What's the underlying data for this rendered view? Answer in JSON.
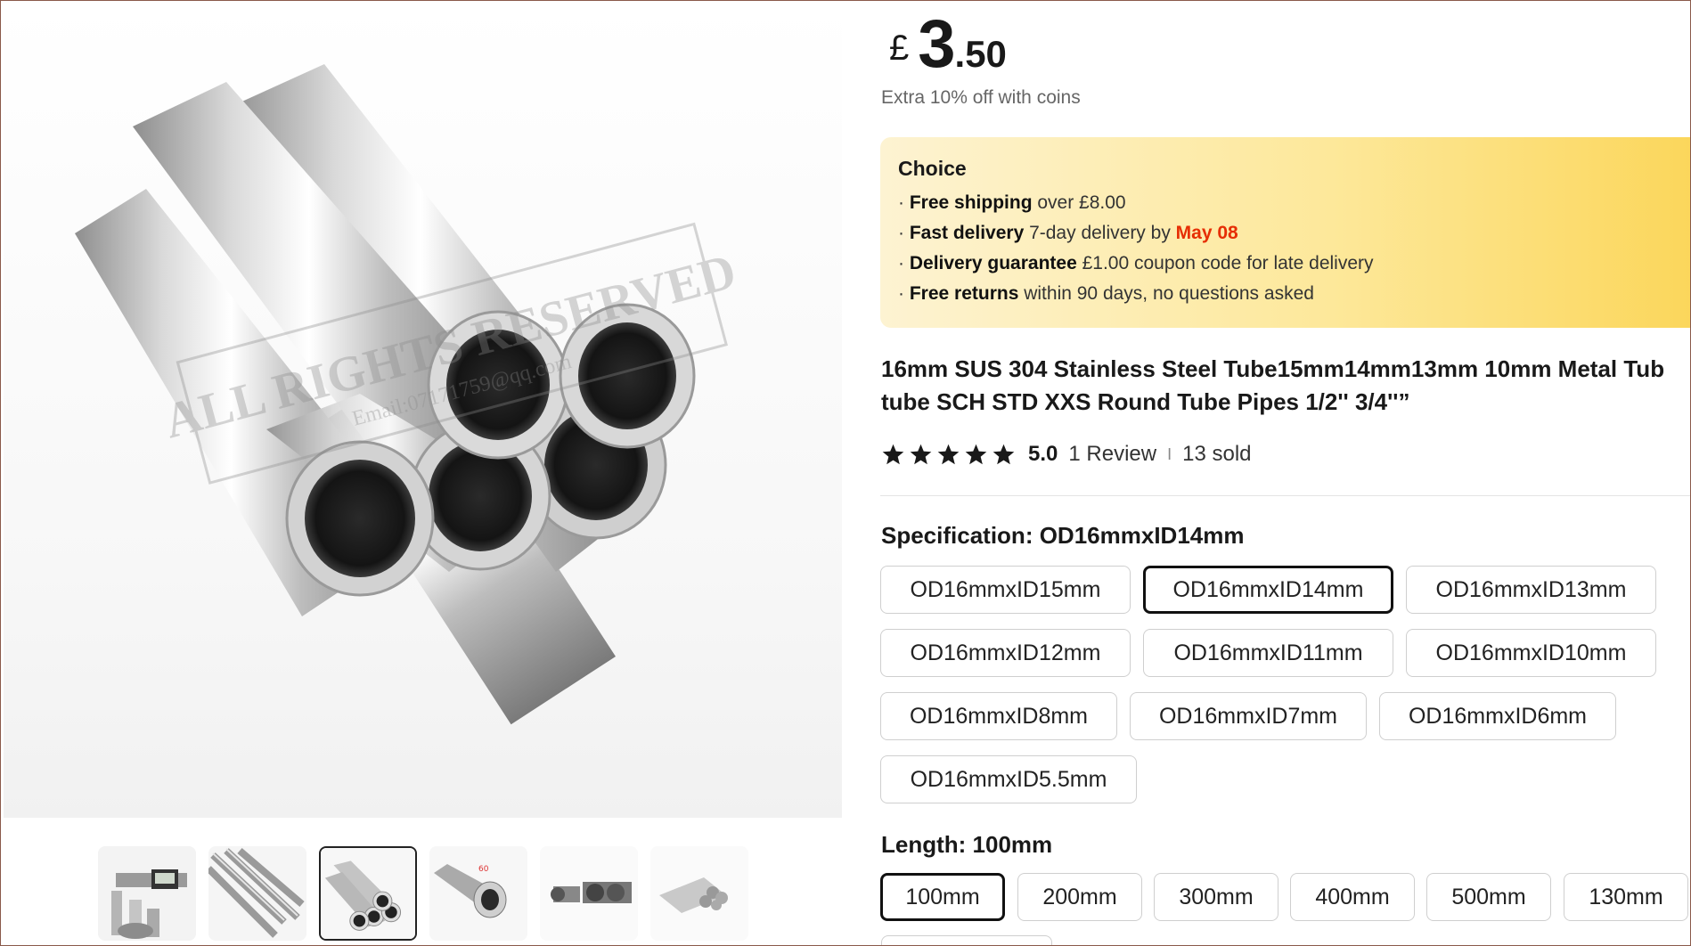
{
  "gallery": {
    "watermark_line1": "ALL RIGHTS RESERVED",
    "watermark_line2": "Email:07171759@qq.com",
    "thumbnails": [
      {
        "name": "thumb-caliper"
      },
      {
        "name": "thumb-tubes-diagonal"
      },
      {
        "name": "thumb-tubes-stack",
        "selected": true
      },
      {
        "name": "thumb-single-tube"
      },
      {
        "name": "thumb-tube-pieces"
      },
      {
        "name": "thumb-tube-bundle"
      }
    ]
  },
  "price": {
    "currency": "£",
    "integer": "3",
    "decimal": ".50"
  },
  "coins_text": "Extra 10% off with coins",
  "choice": {
    "title": "Choice",
    "rows": [
      {
        "bold": "Free shipping",
        "text": " over  £8.00"
      },
      {
        "bold": "Fast delivery",
        "text": " 7-day delivery by ",
        "highlight": "May 08"
      },
      {
        "bold": "Delivery guarantee",
        "text": "  £1.00 coupon code for late delivery"
      },
      {
        "bold": "Free returns",
        "text": "  within 90 days, no questions asked"
      }
    ],
    "bullet": "·"
  },
  "product": {
    "title_line1": "16mm SUS 304 Stainless Steel Tube15mm14mm13mm 10mm Metal Tub",
    "title_line2": "tube SCH STD XXS Round Tube Pipes 1/2'' 3/4''”"
  },
  "rating": {
    "score": "5.0",
    "stars": 5,
    "reviews": "1 Review",
    "separator": "I",
    "sold": "13 sold"
  },
  "specification": {
    "label": "Specification: OD16mmxID14mm",
    "options": [
      "OD16mmxID15mm",
      "OD16mmxID14mm",
      "OD16mmxID13mm",
      "OD16mmxID12mm",
      "OD16mmxID11mm",
      "OD16mmxID10mm",
      "OD16mmxID8mm",
      "OD16mmxID7mm",
      "OD16mmxID6mm",
      "OD16mmxID5.5mm"
    ],
    "selected": "OD16mmxID14mm"
  },
  "length": {
    "label": "Length: 100mm",
    "options": [
      "100mm",
      "200mm",
      "300mm",
      "400mm",
      "500mm",
      "130mm"
    ],
    "selected": "100mm"
  },
  "colors": {
    "accent_date": "#e62e04",
    "selected_border": "#111111"
  }
}
